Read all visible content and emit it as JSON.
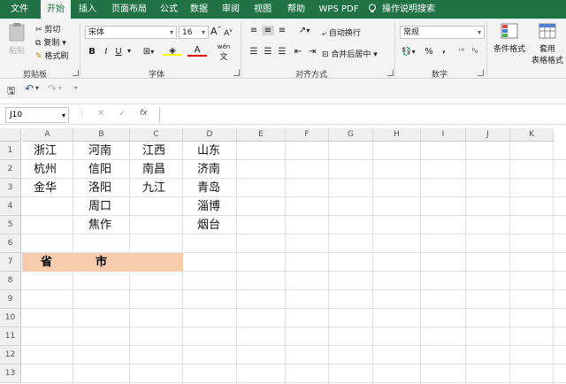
{
  "tabs": [
    "文件",
    "开始",
    "插入",
    "页面布局",
    "公式",
    "数据",
    "审阅",
    "视图",
    "帮助",
    "WPS PDF",
    "操作说明搜索"
  ],
  "ribbon": {
    "clipboard": {
      "paste": "粘贴",
      "cut": "剪切",
      "copy": "复制",
      "format_painter": "格式刷",
      "label": "剪贴板"
    },
    "font": {
      "name": "宋体",
      "size": "16",
      "grow": "A",
      "shrink": "A",
      "bold": "B",
      "italic": "I",
      "underline": "U",
      "color": "A",
      "wen": "wén",
      "label": "字体"
    },
    "alignment": {
      "wrap": "自动换行",
      "merge": "合并后居中",
      "label": "对齐方式"
    },
    "number": {
      "format": "常规",
      "percent": "%",
      "comma": ",",
      "label": "数字"
    },
    "styles": {
      "conditional": "条件格式",
      "table1": "套用",
      "table2": "表格格式"
    }
  },
  "formula_bar": {
    "name_box": "J10",
    "fx": "fx",
    "cancel": "✕",
    "enter": "✓",
    "value": ""
  },
  "columns": [
    "A",
    "B",
    "C",
    "D",
    "E",
    "F",
    "G",
    "H",
    "I",
    "J",
    "K"
  ],
  "rows": [
    "1",
    "2",
    "3",
    "4",
    "5",
    "6",
    "7",
    "8",
    "9",
    "10",
    "11",
    "12",
    "13"
  ],
  "cells": {
    "a1": "浙江",
    "a2": "杭州",
    "a3": "金华",
    "b1": "河南",
    "b2": "信阳",
    "b3": "洛阳",
    "b4": "周口",
    "b5": "焦作",
    "c1": "江西",
    "c2": "南昌",
    "c3": "九江",
    "d1": "山东",
    "d2": "济南",
    "d3": "青岛",
    "d4": "淄博",
    "d5": "烟台",
    "a7": "省",
    "b7": "市"
  },
  "colors": {
    "accent": "#217346",
    "highlight": "#f8cbad"
  }
}
